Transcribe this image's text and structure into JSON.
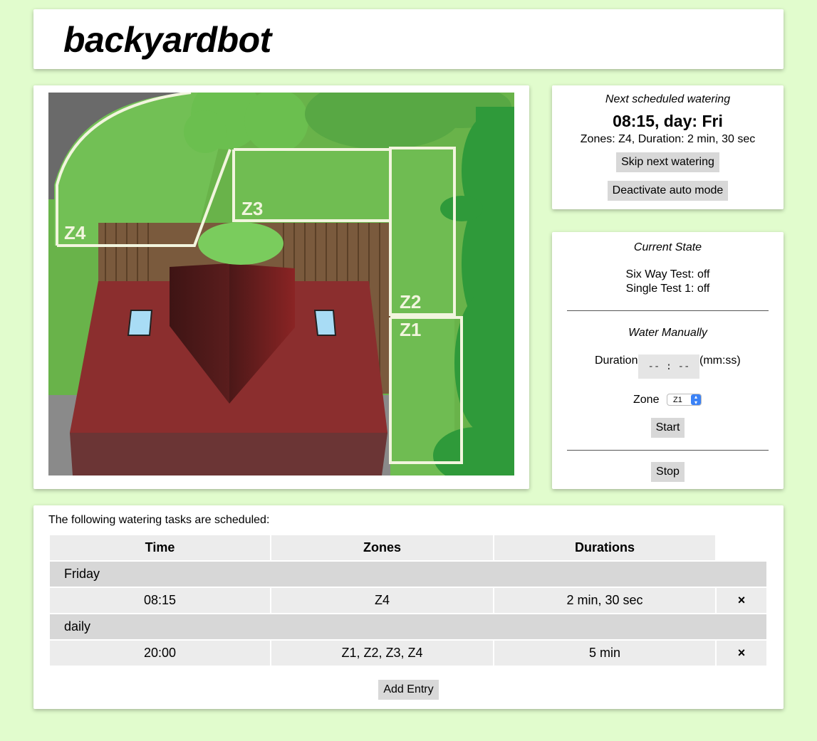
{
  "app": {
    "title": "backyardbot"
  },
  "map": {
    "zones": [
      "Z4",
      "Z3",
      "Z2",
      "Z1"
    ],
    "colors": {
      "lawn": "#6dbb4e",
      "roof": "#8b2e2e",
      "hedge": "#2f9a3a",
      "outline": "#f2f5de"
    }
  },
  "next_watering": {
    "heading": "Next scheduled watering",
    "time": "08:15, day: Fri",
    "details": "Zones: Z4, Duration: 2 min, 30 sec",
    "skip_label": "Skip next watering",
    "deactivate_label": "Deactivate auto mode"
  },
  "current_state": {
    "heading": "Current State",
    "items": [
      "Six Way Test: off",
      "Single Test 1: off"
    ]
  },
  "manual": {
    "heading": "Water Manually",
    "duration_label": "Duration",
    "duration_placeholder": "-- : --",
    "duration_unit": "(mm:ss)",
    "zone_label": "Zone",
    "zone_selected": "Z1",
    "start_label": "Start",
    "stop_label": "Stop"
  },
  "tasks": {
    "intro": "The following watering tasks are scheduled:",
    "headers": [
      "Time",
      "Zones",
      "Durations"
    ],
    "groups": [
      {
        "day": "Friday",
        "rows": [
          {
            "time": "08:15",
            "zones": "Z4",
            "duration": "2 min, 30 sec",
            "delete": "×"
          }
        ]
      },
      {
        "day": "daily",
        "rows": [
          {
            "time": "20:00",
            "zones": "Z1, Z2, Z3, Z4",
            "duration": "5 min",
            "delete": "×"
          }
        ]
      }
    ],
    "add_label": "Add Entry"
  }
}
